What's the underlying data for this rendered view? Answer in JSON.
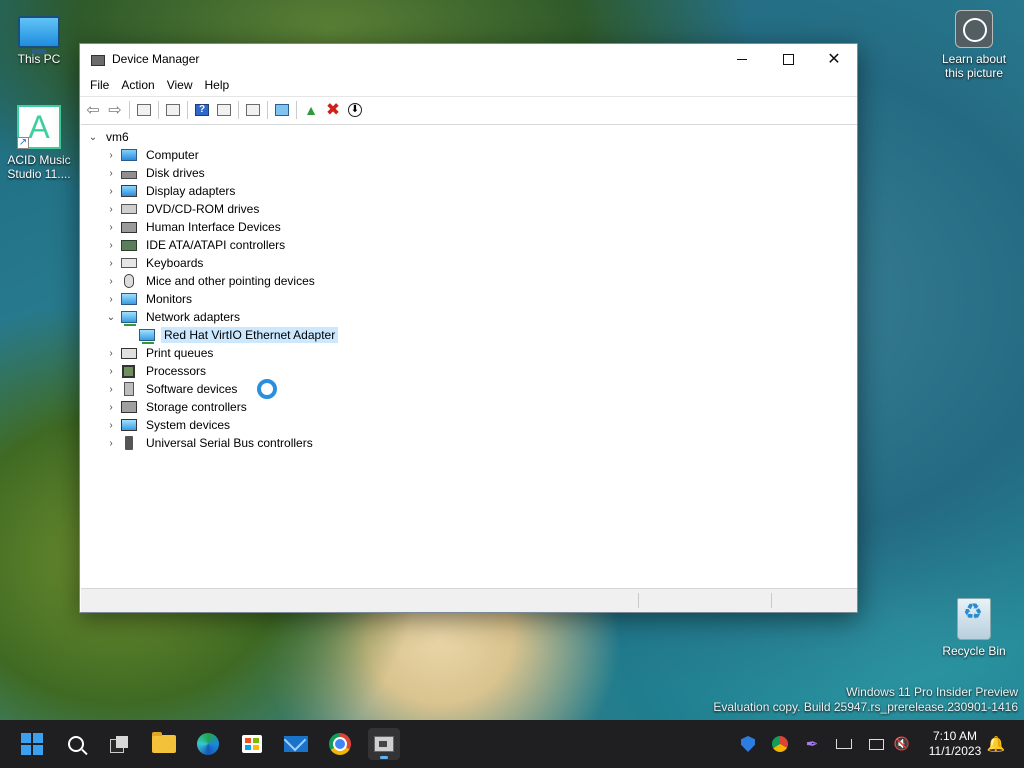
{
  "desktop": {
    "icons": {
      "this_pc": "This PC",
      "acid": "ACID Music Studio 11....",
      "acid_line1": "ACID Music",
      "acid_line2": "Studio 11....",
      "learn_line1": "Learn about",
      "learn_line2": "this picture",
      "recycle": "Recycle Bin"
    },
    "watermark": {
      "line1": "Windows 11 Pro Insider Preview",
      "line2": "Evaluation copy. Build 25947.rs_prerelease.230901-1416"
    }
  },
  "window": {
    "title": "Device Manager",
    "controls": {
      "minimize_icon": "minimize-icon",
      "maximize_icon": "maximize-icon",
      "close_symbol": "✕"
    },
    "menu": [
      "File",
      "Action",
      "View",
      "Help"
    ],
    "toolbar": {
      "icons": [
        "back-arrow-icon",
        "forward-arrow-icon",
        "show-hide-console-tree-icon",
        "properties-icon",
        "help-icon",
        "action-pane-icon",
        "scan-hardware-icon",
        "monitor-icon",
        "update-driver-icon",
        "uninstall-device-icon",
        "disable-device-icon"
      ],
      "help_glyph": "?",
      "back_glyph": "⇦",
      "forward_glyph": "⇨",
      "uninstall_glyph": "✖",
      "disable_glyph": "⬇",
      "update_glyph": "▲"
    },
    "tree": {
      "root": "vm6",
      "categories": [
        "Computer",
        "Disk drives",
        "Display adapters",
        "DVD/CD-ROM drives",
        "Human Interface Devices",
        "IDE ATA/ATAPI controllers",
        "Keyboards",
        "Mice and other pointing devices",
        "Monitors",
        "Network adapters",
        "Print queues",
        "Processors",
        "Software devices",
        "Storage controllers",
        "System devices",
        "Universal Serial Bus controllers"
      ],
      "expanded_category": "Network adapters",
      "child_of_network": "Red Hat VirtIO Ethernet Adapter",
      "selected": "Red Hat VirtIO Ethernet Adapter",
      "chevron_collapsed": "❯",
      "chevron_expanded": "❮"
    }
  },
  "taskbar": {
    "apps": [
      "start-icon",
      "search-icon",
      "task-view-icon",
      "file-explorer-icon",
      "edge-icon",
      "store-icon",
      "mail-icon",
      "chrome-icon",
      "device-manager-icon"
    ],
    "active_app": "device-manager-icon",
    "tray": [
      "security-shield-icon",
      "chrome-tray-icon",
      "pen-icon",
      "network-icon",
      "display-icon",
      "volume-muted-icon"
    ],
    "time": "7:10 AM",
    "date": "11/1/2023",
    "notification_icon": "bell-icon",
    "bell_glyph": "🔔",
    "volume_glyph": "🔇",
    "pen_glyph": "✒"
  },
  "colors": {
    "selection": "#cce8ff",
    "accent": "#2b8fe0",
    "taskbar": "#1f1f22"
  }
}
